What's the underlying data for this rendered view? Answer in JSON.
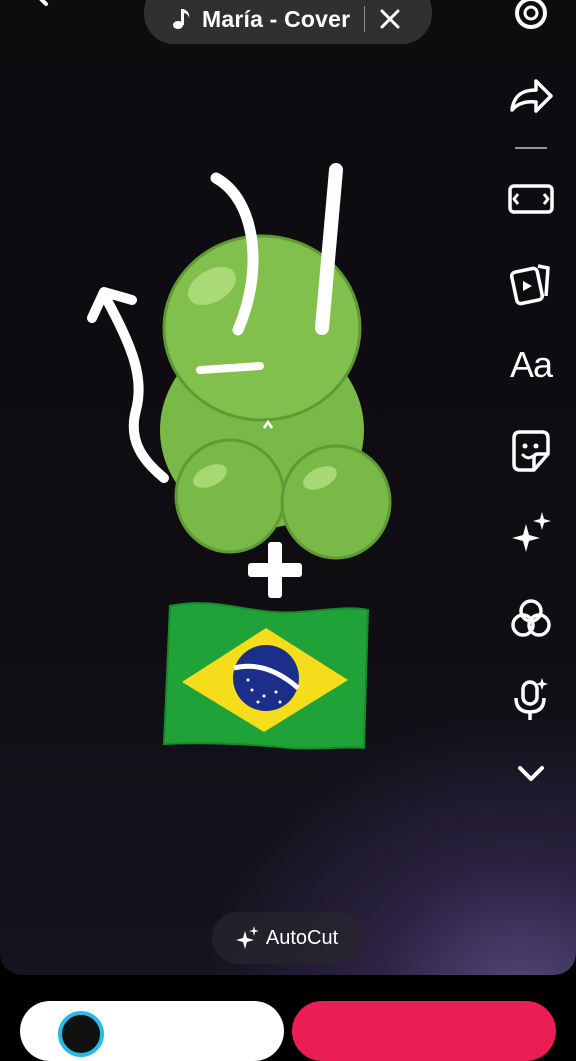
{
  "music": {
    "title": "María - Cover"
  },
  "toolbar": {
    "items": [
      "settings-icon",
      "share-icon",
      "aspect-ratio-icon",
      "clips-icon",
      "text-icon",
      "sticker-icon",
      "effects-icon",
      "filters-icon",
      "voice-icon",
      "more-icon"
    ],
    "text_label": "Aa"
  },
  "autocut": {
    "label": "AutoCut"
  },
  "sticker": {
    "symbol": "+"
  },
  "colors": {
    "gummy": "#7dbe4a",
    "flag_green": "#1fa339",
    "flag_yellow": "#f6dd1c",
    "flag_blue": "#1a2e8a",
    "record_red": "#ea1d55"
  }
}
